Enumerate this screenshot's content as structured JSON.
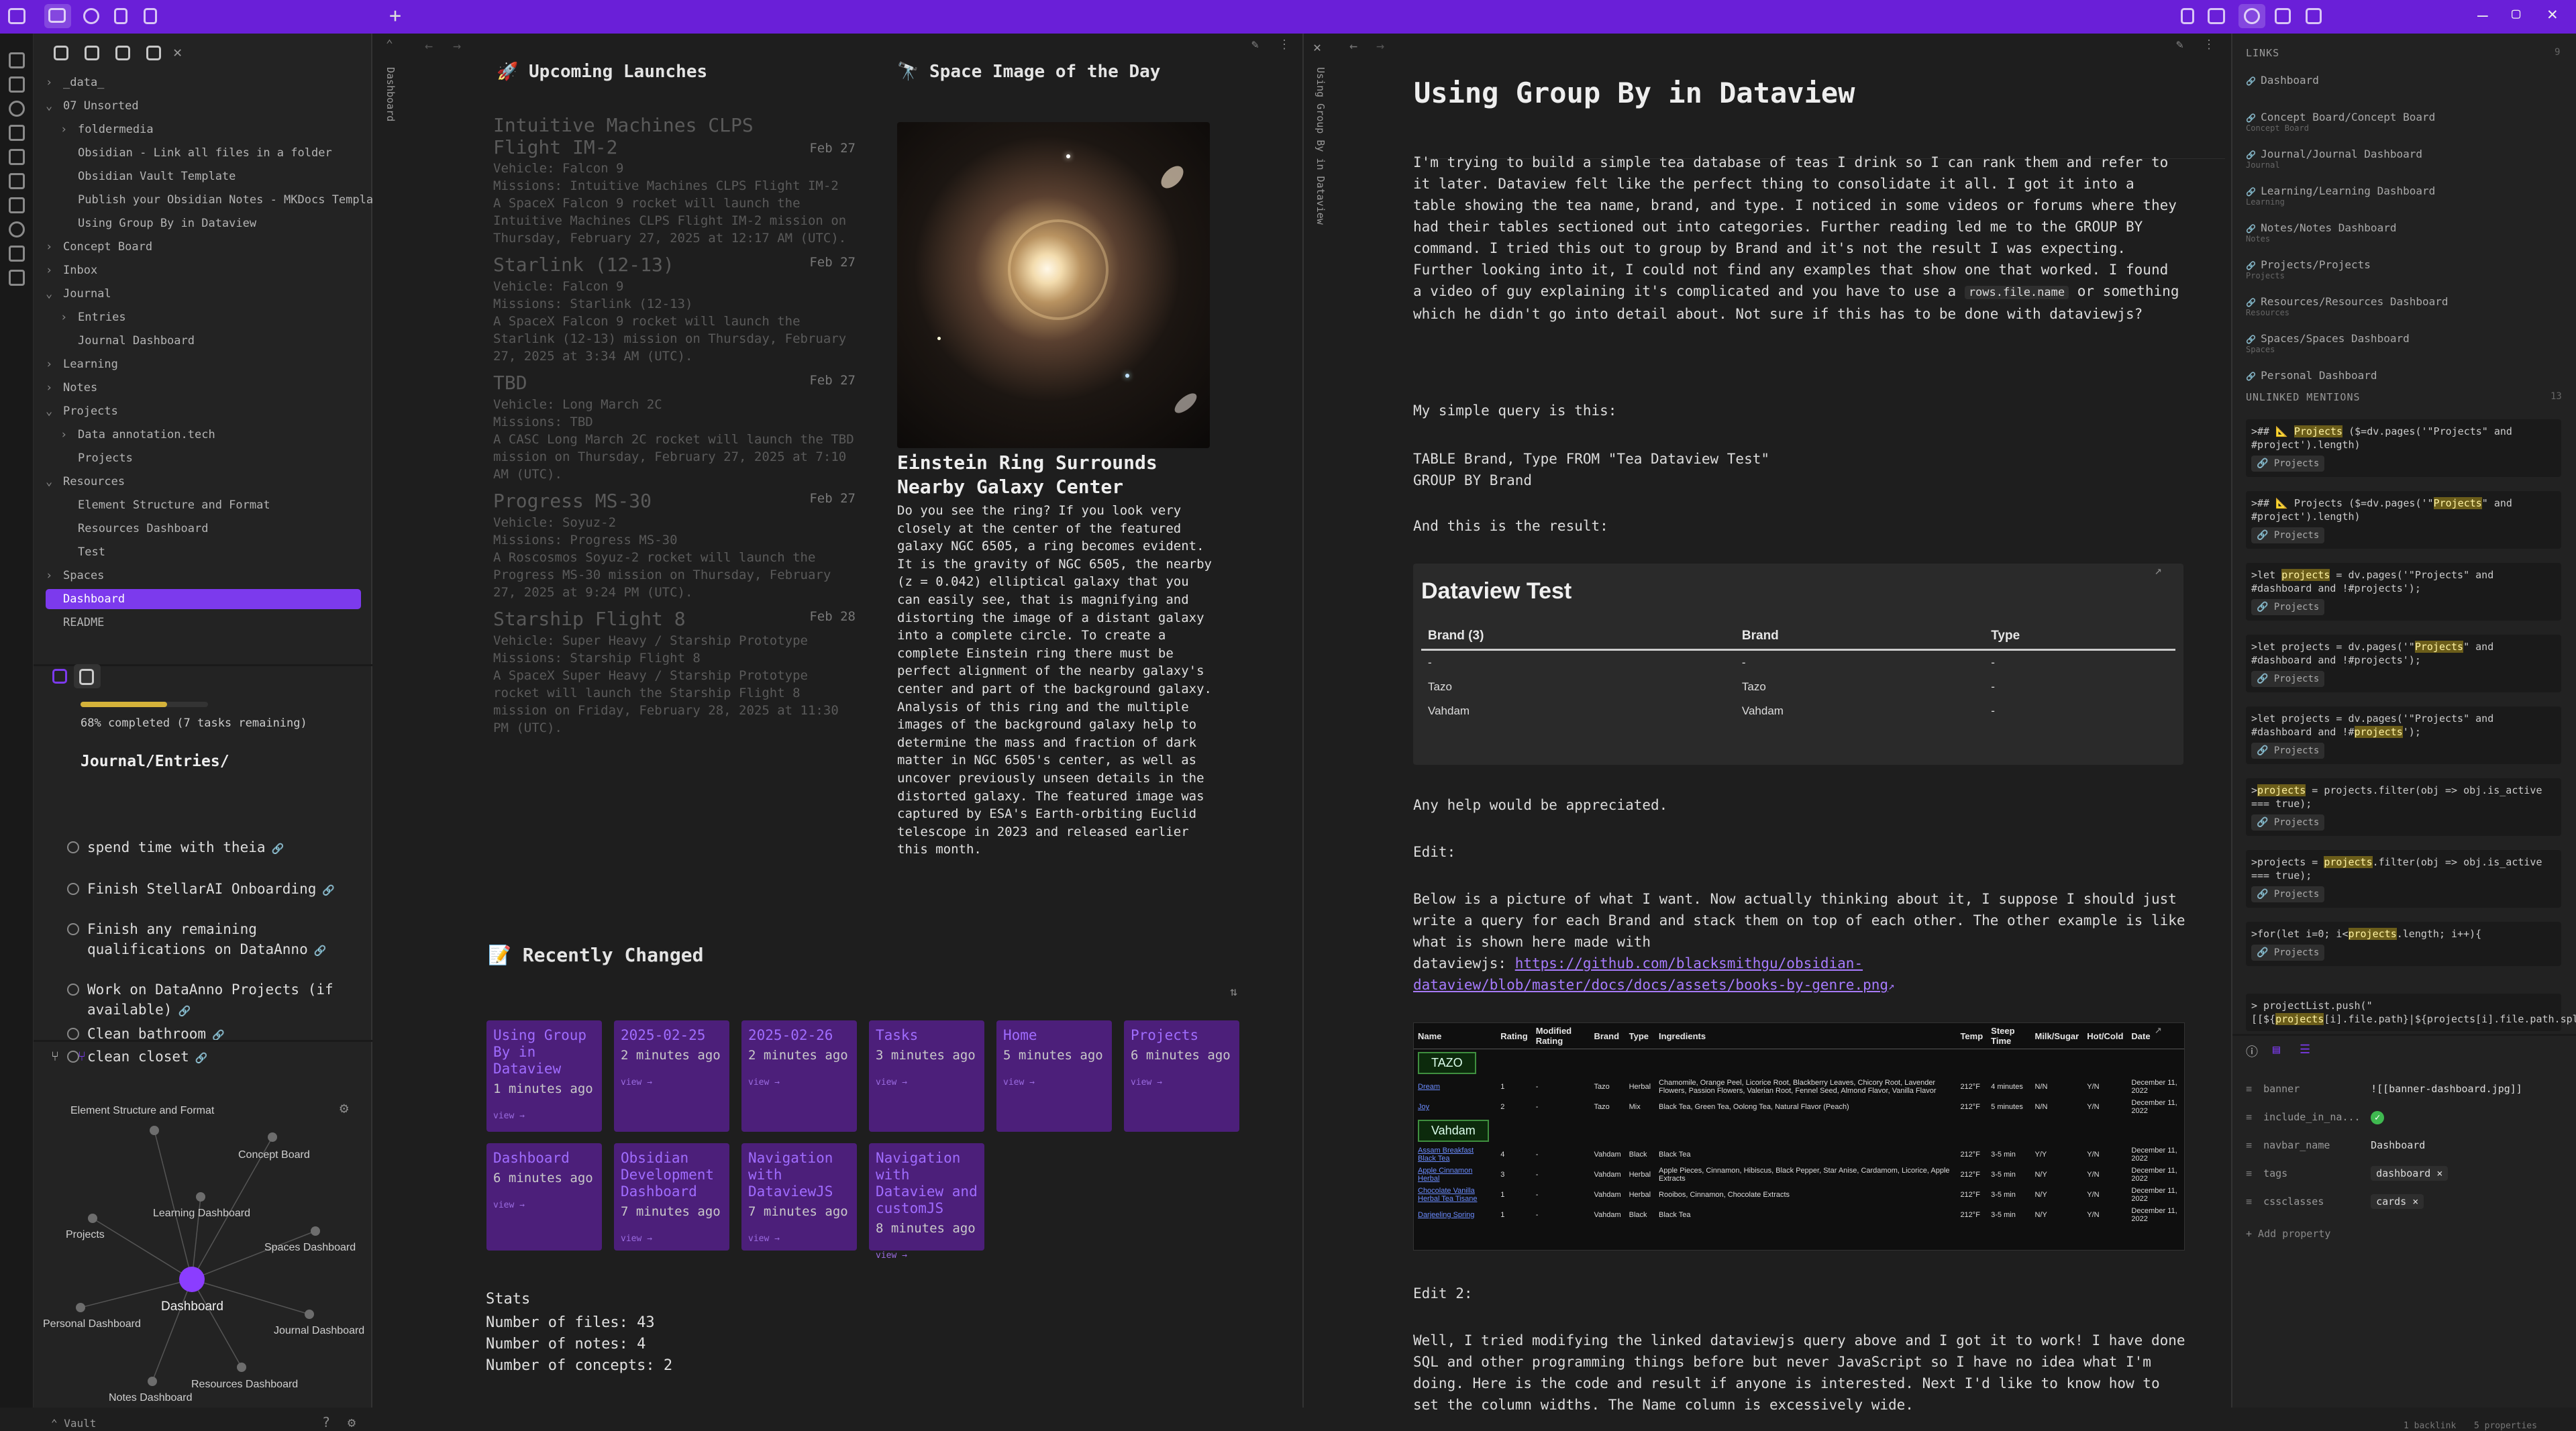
{
  "left_sidebar": {
    "tree": [
      {
        "label": "_data_",
        "indent": 0,
        "chev": "›"
      },
      {
        "label": "07 Unsorted",
        "indent": 0,
        "chev": "⌄"
      },
      {
        "label": "foldermedia",
        "indent": 1,
        "chev": "›"
      },
      {
        "label": "Obsidian - Link all files in a folder",
        "indent": 1,
        "chev": ""
      },
      {
        "label": "Obsidian Vault Template",
        "indent": 1,
        "chev": ""
      },
      {
        "label": "Publish your Obsidian Notes - MKDocs Template",
        "indent": 1,
        "chev": ""
      },
      {
        "label": "Using Group By in Dataview",
        "indent": 1,
        "chev": ""
      },
      {
        "label": "Concept Board",
        "indent": 0,
        "chev": "›"
      },
      {
        "label": "Inbox",
        "indent": 0,
        "chev": "›"
      },
      {
        "label": "Journal",
        "indent": 0,
        "chev": "⌄"
      },
      {
        "label": "Entries",
        "indent": 1,
        "chev": "›"
      },
      {
        "label": "Journal Dashboard",
        "indent": 1,
        "chev": ""
      },
      {
        "label": "Learning",
        "indent": 0,
        "chev": "›"
      },
      {
        "label": "Notes",
        "indent": 0,
        "chev": "›"
      },
      {
        "label": "Projects",
        "indent": 0,
        "chev": "⌄"
      },
      {
        "label": "Data annotation.tech",
        "indent": 1,
        "chev": "›"
      },
      {
        "label": "Projects",
        "indent": 1,
        "chev": ""
      },
      {
        "label": "Resources",
        "indent": 0,
        "chev": "⌄"
      },
      {
        "label": "Element Structure and Format",
        "indent": 1,
        "chev": ""
      },
      {
        "label": "Resources Dashboard",
        "indent": 1,
        "chev": ""
      },
      {
        "label": "Test",
        "indent": 1,
        "chev": ""
      },
      {
        "label": "Spaces",
        "indent": 0,
        "chev": "›"
      },
      {
        "label": "Dashboard",
        "indent": 0,
        "chev": "",
        "selected": true
      },
      {
        "label": "README",
        "indent": 0,
        "chev": ""
      }
    ],
    "progress_text": "68% completed (7 tasks remaining)",
    "progress_value": 0.68,
    "tasks_heading": "Journal/Entries/",
    "tasks": [
      "spend time with theia",
      "Finish StellarAI Onboarding",
      "Finish any remaining qualifications on DataAnno",
      "Work on DataAnno Projects (if available)",
      "Clean bathroom",
      "clean closet"
    ],
    "graph_nodes": [
      {
        "label": "Element Structure and Format"
      },
      {
        "label": "Concept Board"
      },
      {
        "label": "Learning Dashboard"
      },
      {
        "label": "Projects"
      },
      {
        "label": "Spaces Dashboard"
      },
      {
        "label": "Dashboard"
      },
      {
        "label": "Personal Dashboard"
      },
      {
        "label": "Journal Dashboard"
      },
      {
        "label": "Resources Dashboard"
      },
      {
        "label": "Notes Dashboard"
      }
    ],
    "vault_name": "Vault"
  },
  "dashboard": {
    "vertical_tab": "Dashboard",
    "launches_title": "🚀 Upcoming Launches",
    "launches": [
      {
        "name": "Intuitive Machines CLPS Flight IM-2",
        "date": "Feb 27",
        "vehicle": "Vehicle: Falcon 9",
        "missions": "Missions: Intuitive Machines CLPS Flight IM-2",
        "desc": "A SpaceX Falcon 9 rocket will launch the Intuitive Machines CLPS Flight IM-2 mission on Thursday, February 27, 2025 at 12:17 AM (UTC)."
      },
      {
        "name": "Starlink (12-13)",
        "date": "Feb 27",
        "vehicle": "Vehicle: Falcon 9",
        "missions": "Missions: Starlink (12-13)",
        "desc": "A SpaceX Falcon 9 rocket will launch the Starlink (12-13) mission on Thursday, February 27, 2025 at 3:34 AM (UTC)."
      },
      {
        "name": "TBD",
        "date": "Feb 27",
        "vehicle": "Vehicle: Long March 2C",
        "missions": "Missions: TBD",
        "desc": "A CASC Long March 2C rocket will launch the TBD mission on Thursday, February 27, 2025 at 7:10 AM (UTC)."
      },
      {
        "name": "Progress MS-30",
        "date": "Feb 27",
        "vehicle": "Vehicle: Soyuz-2",
        "missions": "Missions: Progress MS-30",
        "desc": "A Roscosmos Soyuz-2 rocket will launch the Progress MS-30 mission on Thursday, February 27, 2025 at 9:24 PM (UTC)."
      },
      {
        "name": "Starship Flight 8",
        "date": "Feb 28",
        "vehicle": "Vehicle: Super Heavy / Starship Prototype",
        "missions": "Missions: Starship Flight 8",
        "desc": "A SpaceX Super Heavy / Starship Prototype rocket will launch the Starship Flight 8 mission on Friday, February 28, 2025 at 11:30 PM (UTC)."
      }
    ],
    "apod_title": "🔭 Space Image of the Day",
    "apod_heading": "Einstein Ring Surrounds Nearby Galaxy Center",
    "apod_text": "Do you see the ring? If you look very closely at the center of the featured galaxy NGC 6505, a ring becomes evident. It is the gravity of NGC 6505, the nearby (z = 0.042) elliptical galaxy that you can easily see, that is magnifying and distorting the image of a distant galaxy into a complete circle. To create a complete Einstein ring there must be perfect alignment of the nearby galaxy's center and part of the background galaxy. Analysis of this ring and the multiple images of the background galaxy help to determine the mass and fraction of dark matter in NGC 6505's center, as well as uncover previously unseen details in the distorted galaxy. The featured image was captured by ESA's Earth-orbiting Euclid telescope in 2023 and released earlier this month.",
    "recent_title": "📝 Recently Changed",
    "recent_cards": [
      {
        "title": "Using Group By in Dataview",
        "time": "1 minutes ago",
        "view": "view →"
      },
      {
        "title": "2025-02-25",
        "time": "2 minutes ago",
        "view": "view →"
      },
      {
        "title": "2025-02-26",
        "time": "2 minutes ago",
        "view": "view →"
      },
      {
        "title": "Tasks",
        "time": "3 minutes ago",
        "view": "view →"
      },
      {
        "title": "Home",
        "time": "5 minutes ago",
        "view": "view →"
      },
      {
        "title": "Projects",
        "time": "6 minutes ago",
        "view": "view →"
      },
      {
        "title": "Dashboard",
        "time": "6 minutes ago",
        "view": "view →"
      },
      {
        "title": "Obsidian Development Dashboard",
        "time": "7 minutes ago",
        "view": "view →"
      },
      {
        "title": "Navigation with DataviewJS",
        "time": "7 minutes ago",
        "view": "view →"
      },
      {
        "title": "Navigation with Dataview and customJS",
        "time": "8 minutes ago",
        "view": "view →"
      }
    ],
    "stats_title": "Stats",
    "stats": [
      "Number of files: 43",
      "Number of notes: 4",
      "Number of concepts: 2"
    ]
  },
  "note": {
    "vertical_tab": "Using Group By in Dataview",
    "title": "Using Group By in Dataview",
    "para1_a": "I'm trying to build a simple tea database of teas I drink so I can rank them and refer to it later. Dataview felt like the perfect thing to consolidate it all. I got it into a table showing the tea name, brand, and type. I noticed in some videos or forums where they had their tables sectioned out into categories. Further reading led me to the GROUP BY command. I tried this out to group by Brand and it's not the result I was expecting. Further looking into it, I could not find any examples that show one that worked. I found a video of guy explaining it's complicated and you have to use a ",
    "para1_code": "rows.file.name",
    "para1_b": " or something which he didn't go into detail about. Not sure if this has to be done with dataviewjs?",
    "para2": "My simple query is this:",
    "query1": "TABLE Brand, Type FROM \"Tea Dataview Test\"",
    "query2": "GROUP BY Brand",
    "para3": "And this is the result:",
    "dv_title": "Dataview Test",
    "dv_headers": [
      "Brand (3)",
      "Brand",
      "Type"
    ],
    "dv_rows": [
      [
        "-",
        "-",
        "-"
      ],
      [
        "Tazo",
        "Tazo",
        "-"
      ],
      [
        "Vahdam",
        "Vahdam",
        "-"
      ]
    ],
    "para4": "Any help would be appreciated.",
    "edit1": "Edit:",
    "para5": "Below is a picture of what I want. Now actually thinking about it, I suppose I should just write a query for each Brand and stack them on top of each other. The other example is like what is shown here made with",
    "para5_prefix": "dataviewjs: ",
    "para5_link": "https://github.com/blacksmithgu/obsidian-dataview/blob/master/docs/docs/assets/books-by-genre.png",
    "img_headers": [
      "Name",
      "Rating",
      "Modified Rating",
      "Brand",
      "Type",
      "Ingredients",
      "Temp",
      "Steep Time",
      "Milk/Sugar",
      "Hot/Cold",
      "Date"
    ],
    "img_groups": [
      "TAZO",
      "Vahdam"
    ],
    "img_rows": [
      [
        "Dream",
        "1",
        "-",
        "Tazo",
        "Herbal",
        "Chamomile, Orange Peel, Licorice Root, Blackberry Leaves, Chicory Root, Lavender Flowers, Passion Flowers, Valerian Root, Fennel Seed, Almond Flavor, Vanilla Flavor",
        "212°F",
        "4 minutes",
        "N/N",
        "Y/N",
        "December 11, 2022"
      ],
      [
        "Joy",
        "2",
        "-",
        "Tazo",
        "Mix",
        "Black Tea, Green Tea, Oolong Tea, Natural Flavor (Peach)",
        "212°F",
        "5 minutes",
        "N/N",
        "Y/N",
        "December 11, 2022"
      ],
      [
        "Assam Breakfast Black Tea",
        "4",
        "-",
        "Vahdam",
        "Black",
        "Black Tea",
        "212°F",
        "3-5 min",
        "Y/Y",
        "Y/N",
        "December 11, 2022"
      ],
      [
        "Apple Cinnamon Herbal",
        "3",
        "-",
        "Vahdam",
        "Herbal",
        "Apple Pieces, Cinnamon, Hibiscus, Black Pepper, Star Anise, Cardamom, Licorice, Apple Extracts",
        "212°F",
        "3-5 min",
        "N/Y",
        "Y/N",
        "December 11, 2022"
      ],
      [
        "Chocolate Vanilla Herbal Tea Tisane",
        "1",
        "-",
        "Vahdam",
        "Herbal",
        "Rooibos, Cinnamon, Chocolate Extracts",
        "212°F",
        "3-5 min",
        "N/Y",
        "Y/N",
        "December 11, 2022"
      ],
      [
        "Darjeeling Spring",
        "1",
        "-",
        "Vahdam",
        "Black",
        "Black Tea",
        "212°F",
        "3-5 min",
        "N/Y",
        "Y/N",
        "December 11, 2022"
      ]
    ],
    "edit2": "Edit 2:",
    "para6": "Well, I tried modifying the linked dataviewjs query above and I got it to work! I have done SQL and other programming things before but never JavaScript so I have no idea what I'm doing. Here is the code and result if anyone is interested. Next I'd like to know how to set the column widths. The Name column is excessively wide."
  },
  "right_sidebar": {
    "links_title": "LINKS",
    "links_count": "9",
    "links": [
      {
        "label": "Dashboard",
        "sub": ""
      },
      {
        "label": "Concept Board/Concept Board",
        "sub": "Concept Board"
      },
      {
        "label": "Journal/Journal Dashboard",
        "sub": "Journal"
      },
      {
        "label": "Learning/Learning Dashboard",
        "sub": "Learning"
      },
      {
        "label": "Notes/Notes Dashboard",
        "sub": "Notes"
      },
      {
        "label": "Projects/Projects",
        "sub": "Projects"
      },
      {
        "label": "Resources/Resources Dashboard",
        "sub": "Resources"
      },
      {
        "label": "Spaces/Spaces Dashboard",
        "sub": "Spaces"
      },
      {
        "label": "Personal Dashboard",
        "sub": ""
      }
    ],
    "unlinked_title": "UNLINKED MENTIONS",
    "unlinked_count": "13",
    "mentions": [
      {
        "pre": ">## 📐 ",
        "hl": "Projects",
        "post": " ($=dv.pages('\"Projects\" and #project').length)",
        "chip": "Projects"
      },
      {
        "pre": ">## 📐 Projects ($=dv.pages('\"",
        "hl": "Projects",
        "post": "\" and #project').length)",
        "chip": "Projects"
      },
      {
        "pre": ">let ",
        "hl": "projects",
        "post": " = dv.pages('\"Projects\" and #dashboard and !#projects');",
        "chip": "Projects"
      },
      {
        "pre": ">let projects = dv.pages('\"",
        "hl": "Projects",
        "post": "\" and #dashboard and !#projects');",
        "chip": "Projects"
      },
      {
        "pre": ">let projects = dv.pages('\"Projects\" and #dashboard and !#",
        "hl": "projects",
        "post": "');",
        "chip": "Projects"
      },
      {
        "pre": ">",
        "hl": "projects",
        "post": " = projects.filter(obj => obj.is_active === true);",
        "chip": "Projects"
      },
      {
        "pre": ">projects = ",
        "hl": "projects",
        "post": ".filter(obj => obj.is_active === true);",
        "chip": "Projects"
      },
      {
        "pre": ">for(let i=0; i<",
        "hl": "projects",
        "post": ".length; i++){",
        "chip": "Projects"
      },
      {
        "pre": "> projectList.push(\"[[${",
        "hl": "projects",
        "post": "[i].file.path}|${projects[i].file.path.split('/')",
        "chip": ""
      }
    ],
    "properties": [
      {
        "key": "banner",
        "value": "![[banner-dashboard.jpg]]"
      },
      {
        "key": "include_in_na...",
        "value": "✓"
      },
      {
        "key": "navbar_name",
        "value": "Dashboard"
      },
      {
        "key": "tags",
        "value": "dashboard ×"
      },
      {
        "key": "cssclasses",
        "value": "cards ×"
      }
    ],
    "add_property": "+ Add property",
    "status_backlinks": "1 backlink",
    "status_props": "5 properties"
  }
}
